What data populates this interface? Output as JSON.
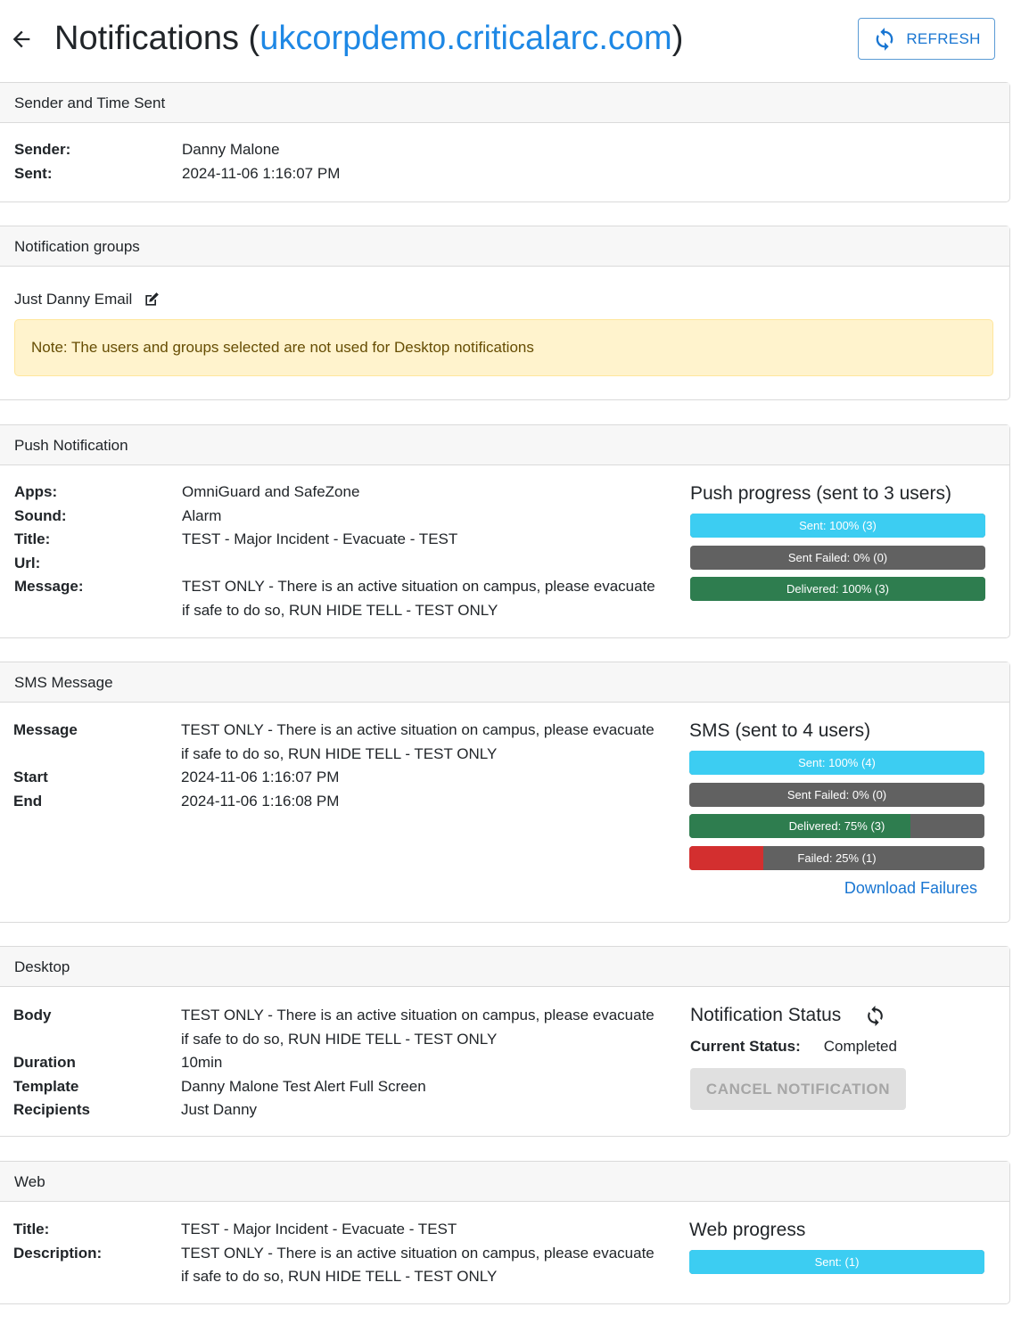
{
  "header": {
    "title_prefix": "Notifications (",
    "domain": "ukcorpdemo.criticalarc.com",
    "title_suffix": ")",
    "refresh_label": "REFRESH",
    "back_icon": "arrow-left-icon",
    "refresh_icon": "sync-icon"
  },
  "sender_section": {
    "title": "Sender and Time Sent",
    "rows": [
      {
        "key": "Sender:",
        "value": "Danny Malone"
      },
      {
        "key": "Sent:",
        "value": "2024-11-06 1:16:07 PM"
      }
    ]
  },
  "groups_section": {
    "title": "Notification groups",
    "group_name": "Just Danny Email",
    "edit_icon": "edit-icon",
    "note": "Note: The users and groups selected are not used for Desktop notifications"
  },
  "push_section": {
    "title": "Push Notification",
    "rows": [
      {
        "key": "Apps:",
        "value": "OmniGuard and SafeZone"
      },
      {
        "key": "Sound:",
        "value": "Alarm"
      },
      {
        "key": "Title:",
        "value": "TEST - Major Incident - Evacuate - TEST"
      },
      {
        "key": "Url:",
        "value": ""
      },
      {
        "key": "Message:",
        "value": "TEST ONLY - There is an active situation on campus, please evacuate if safe to do so, RUN HIDE TELL - TEST ONLY"
      }
    ],
    "progress_title": "Push progress (sent to 3 users)",
    "bars": [
      {
        "label": "Sent: 100% (3)",
        "value": 1.0,
        "color": "#3ccdf2"
      },
      {
        "label": "Sent Failed: 0% (0)",
        "value": 0.0,
        "color": "#616161"
      },
      {
        "label": "Delivered: 100% (3)",
        "value": 1.0,
        "color": "#2e7d4f"
      }
    ]
  },
  "sms_section": {
    "title": "SMS Message",
    "rows": [
      {
        "key": "Message",
        "value": "TEST ONLY - There is an active situation on campus, please evacuate if safe to do so, RUN HIDE TELL - TEST ONLY"
      },
      {
        "key": "Start",
        "value": "2024-11-06 1:16:07 PM"
      },
      {
        "key": "End",
        "value": "2024-11-06 1:16:08 PM"
      }
    ],
    "progress_title": "SMS (sent to 4 users)",
    "bars": [
      {
        "label": "Sent: 100% (4)",
        "value": 1.0,
        "color": "#3ccdf2"
      },
      {
        "label": "Sent Failed: 0% (0)",
        "value": 0.0,
        "color": "#616161"
      },
      {
        "label": "Delivered: 75% (3)",
        "value": 0.75,
        "color": "#2e7d4f"
      },
      {
        "label": "Failed: 25% (1)",
        "value": 0.25,
        "color": "#d32f2f"
      }
    ],
    "download_label": "Download Failures"
  },
  "desktop_section": {
    "title": "Desktop",
    "rows": [
      {
        "key": "Body",
        "value": "TEST ONLY - There is an active situation on campus, please evacuate if safe to do so, RUN HIDE TELL - TEST ONLY"
      },
      {
        "key": "Duration",
        "value": "10min"
      },
      {
        "key": "Template",
        "value": "Danny Malone Test Alert Full Screen"
      },
      {
        "key": "Recipients",
        "value": "Just Danny"
      }
    ],
    "status_title": "Notification Status",
    "status_label": "Current Status:",
    "status_value": "Completed",
    "cancel_label": "CANCEL NOTIFICATION",
    "status_refresh_icon": "sync-icon"
  },
  "web_section": {
    "title": "Web",
    "rows": [
      {
        "key": "Title:",
        "value": "TEST - Major Incident - Evacuate - TEST"
      },
      {
        "key": "Description:",
        "value": "TEST ONLY - There is an active situation on campus, please evacuate if safe to do so, RUN HIDE TELL - TEST ONLY"
      }
    ],
    "progress_title": "Web progress",
    "bars": [
      {
        "label": "Sent: (1)",
        "value": 1.0,
        "color": "#3ccdf2"
      }
    ]
  }
}
